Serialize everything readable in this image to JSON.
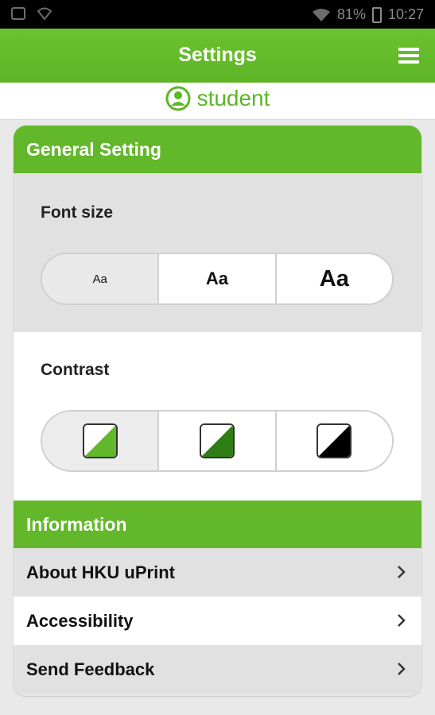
{
  "status_bar": {
    "battery": "81%",
    "time": "10:27"
  },
  "header": {
    "title": "Settings"
  },
  "user": {
    "name": "student"
  },
  "general": {
    "title": "General Setting",
    "font_size_label": "Font size",
    "font_size_options": [
      "Aa",
      "Aa",
      "Aa"
    ],
    "contrast_label": "Contrast"
  },
  "information": {
    "title": "Information",
    "items": [
      "About HKU uPrint",
      "Accessibility",
      "Send Feedback"
    ]
  },
  "colors": {
    "accent": "#62b82a",
    "dark_green": "#2e7d12",
    "black": "#000000"
  }
}
